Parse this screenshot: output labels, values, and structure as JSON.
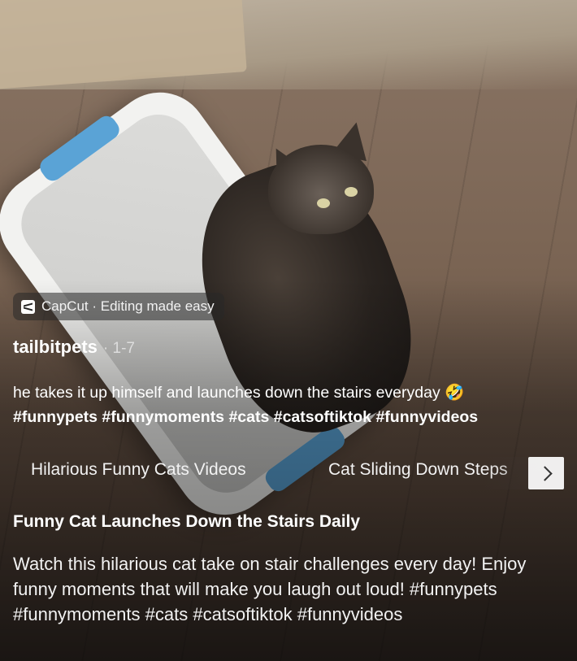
{
  "capcut_badge": {
    "text": "CapCut · Editing made easy"
  },
  "post": {
    "author": "tailbitpets",
    "date": "· 1-7",
    "caption_text": "he takes it up himself and launches down the stairs everyday 🤣",
    "caption_hashtags": "#funnypets #funnymoments #cats #catsoftiktok #funnyvideos"
  },
  "related_searches": [
    {
      "label": "Hilarious Funny Cats Videos"
    },
    {
      "label": "Cat Sliding Down Steps"
    }
  ],
  "next_icon": "chevron-right-icon",
  "video_info": {
    "title": "Funny Cat Launches Down the Stairs Daily",
    "description": "Watch this hilarious cat take on stair challenges every day! Enjoy funny moments that will make you laugh out loud! #funnypets #funnymoments #cats #catsoftiktok #funnyvideos"
  }
}
